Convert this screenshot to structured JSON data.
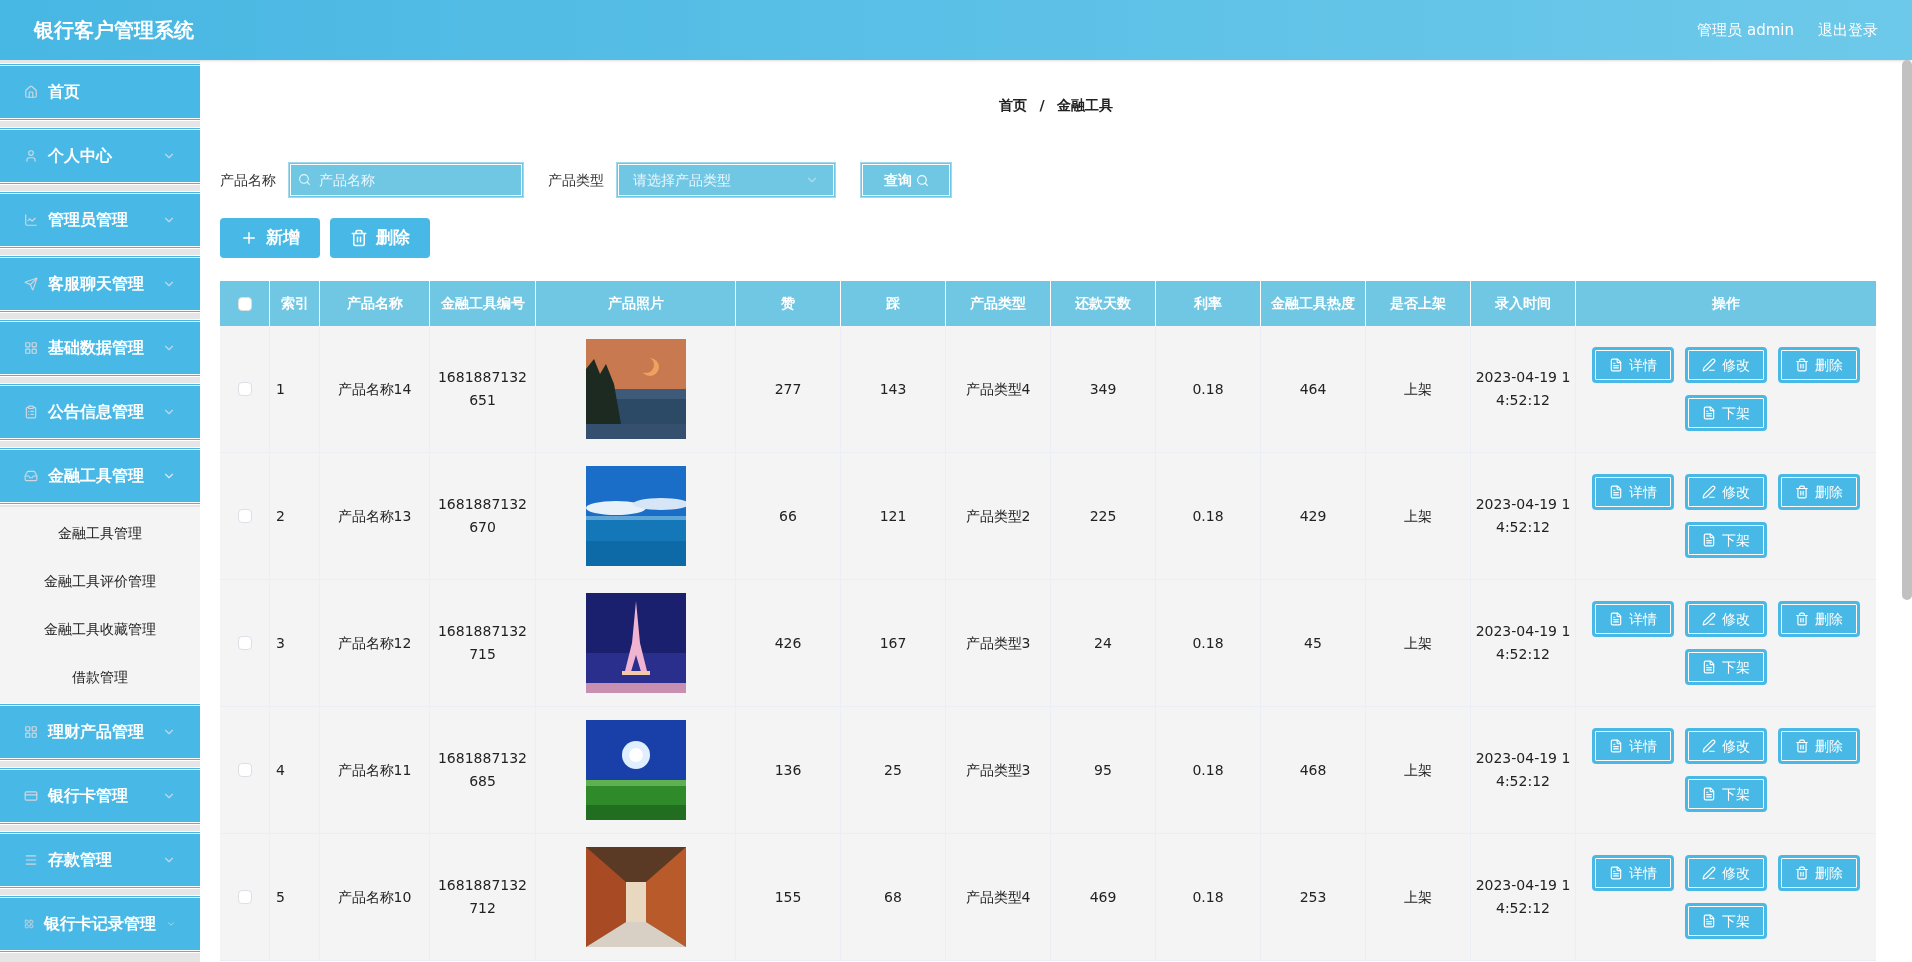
{
  "header": {
    "title": "银行客户管理系统",
    "user": "管理员 admin",
    "logout": "退出登录"
  },
  "sidebar": {
    "items": [
      {
        "label": "首页",
        "kind": "link"
      },
      {
        "label": "个人中心",
        "kind": "menu",
        "expanded": false
      },
      {
        "label": "管理员管理",
        "kind": "menu",
        "expanded": false
      },
      {
        "label": "客服聊天管理",
        "kind": "menu",
        "expanded": false
      },
      {
        "label": "基础数据管理",
        "kind": "menu",
        "expanded": false
      },
      {
        "label": "公告信息管理",
        "kind": "menu",
        "expanded": false
      },
      {
        "label": "金融工具管理",
        "kind": "menu",
        "expanded": true,
        "children": [
          "金融工具管理",
          "金融工具评价管理",
          "金融工具收藏管理",
          "借款管理"
        ]
      },
      {
        "label": "理财产品管理",
        "kind": "menu",
        "expanded": false
      },
      {
        "label": "银行卡管理",
        "kind": "menu",
        "expanded": false
      },
      {
        "label": "存款管理",
        "kind": "menu",
        "expanded": false
      },
      {
        "label": "银行卡记录管理",
        "kind": "menu",
        "expanded": false
      }
    ]
  },
  "breadcrumb": {
    "items": [
      "首页",
      "金融工具"
    ],
    "separator": "/"
  },
  "search": {
    "fields": [
      {
        "label": "产品名称",
        "placeholder": "产品名称",
        "kind": "text"
      },
      {
        "label": "产品类型",
        "placeholder": "请选择产品类型",
        "kind": "select"
      }
    ],
    "button": "查询"
  },
  "actions": [
    {
      "label": "新增",
      "kind": "add"
    },
    {
      "label": "删除",
      "kind": "delete"
    }
  ],
  "table": {
    "select_all": {
      "checked": false
    },
    "columns": [
      "索引",
      "产品名称",
      "金融工具编号",
      "产品照片",
      "赞",
      "踩",
      "产品类型",
      "还款天数",
      "利率",
      "金融工具热度",
      "是否上架",
      "录入时间",
      "操作"
    ],
    "rows": [
      {
        "checked": false,
        "cells": [
          "1",
          "产品名称14",
          "1681887132651",
          {
            "kind": "picture"
          },
          "277",
          "143",
          "产品类型4",
          "349",
          "0.18",
          "464",
          "上架",
          "2023-04-19 14:52:12"
        ],
        "buttons": [
          "详情",
          "修改",
          "删除",
          "下架"
        ]
      },
      {
        "checked": false,
        "cells": [
          "2",
          "产品名称13",
          "1681887132670",
          {
            "kind": "picture"
          },
          "66",
          "121",
          "产品类型2",
          "225",
          "0.18",
          "429",
          "上架",
          "2023-04-19 14:52:12"
        ],
        "buttons": [
          "详情",
          "修改",
          "删除",
          "下架"
        ]
      },
      {
        "checked": false,
        "cells": [
          "3",
          "产品名称12",
          "1681887132715",
          {
            "kind": "picture"
          },
          "426",
          "167",
          "产品类型3",
          "24",
          "0.18",
          "45",
          "上架",
          "2023-04-19 14:52:12"
        ],
        "buttons": [
          "详情",
          "修改",
          "删除",
          "下架"
        ]
      },
      {
        "checked": false,
        "cells": [
          "4",
          "产品名称11",
          "1681887132685",
          {
            "kind": "picture"
          },
          "136",
          "25",
          "产品类型3",
          "95",
          "0.18",
          "468",
          "上架",
          "2023-04-19 14:52:12"
        ],
        "buttons": [
          "详情",
          "修改",
          "删除",
          "下架"
        ]
      },
      {
        "checked": false,
        "cells": [
          "5",
          "产品名称10",
          "1681887132712",
          {
            "kind": "picture"
          },
          "155",
          "68",
          "产品类型4",
          "469",
          "0.18",
          "253",
          "上架",
          "2023-04-19 14:52:12"
        ],
        "buttons": [
          "详情",
          "修改",
          "删除",
          "下架"
        ]
      }
    ]
  }
}
